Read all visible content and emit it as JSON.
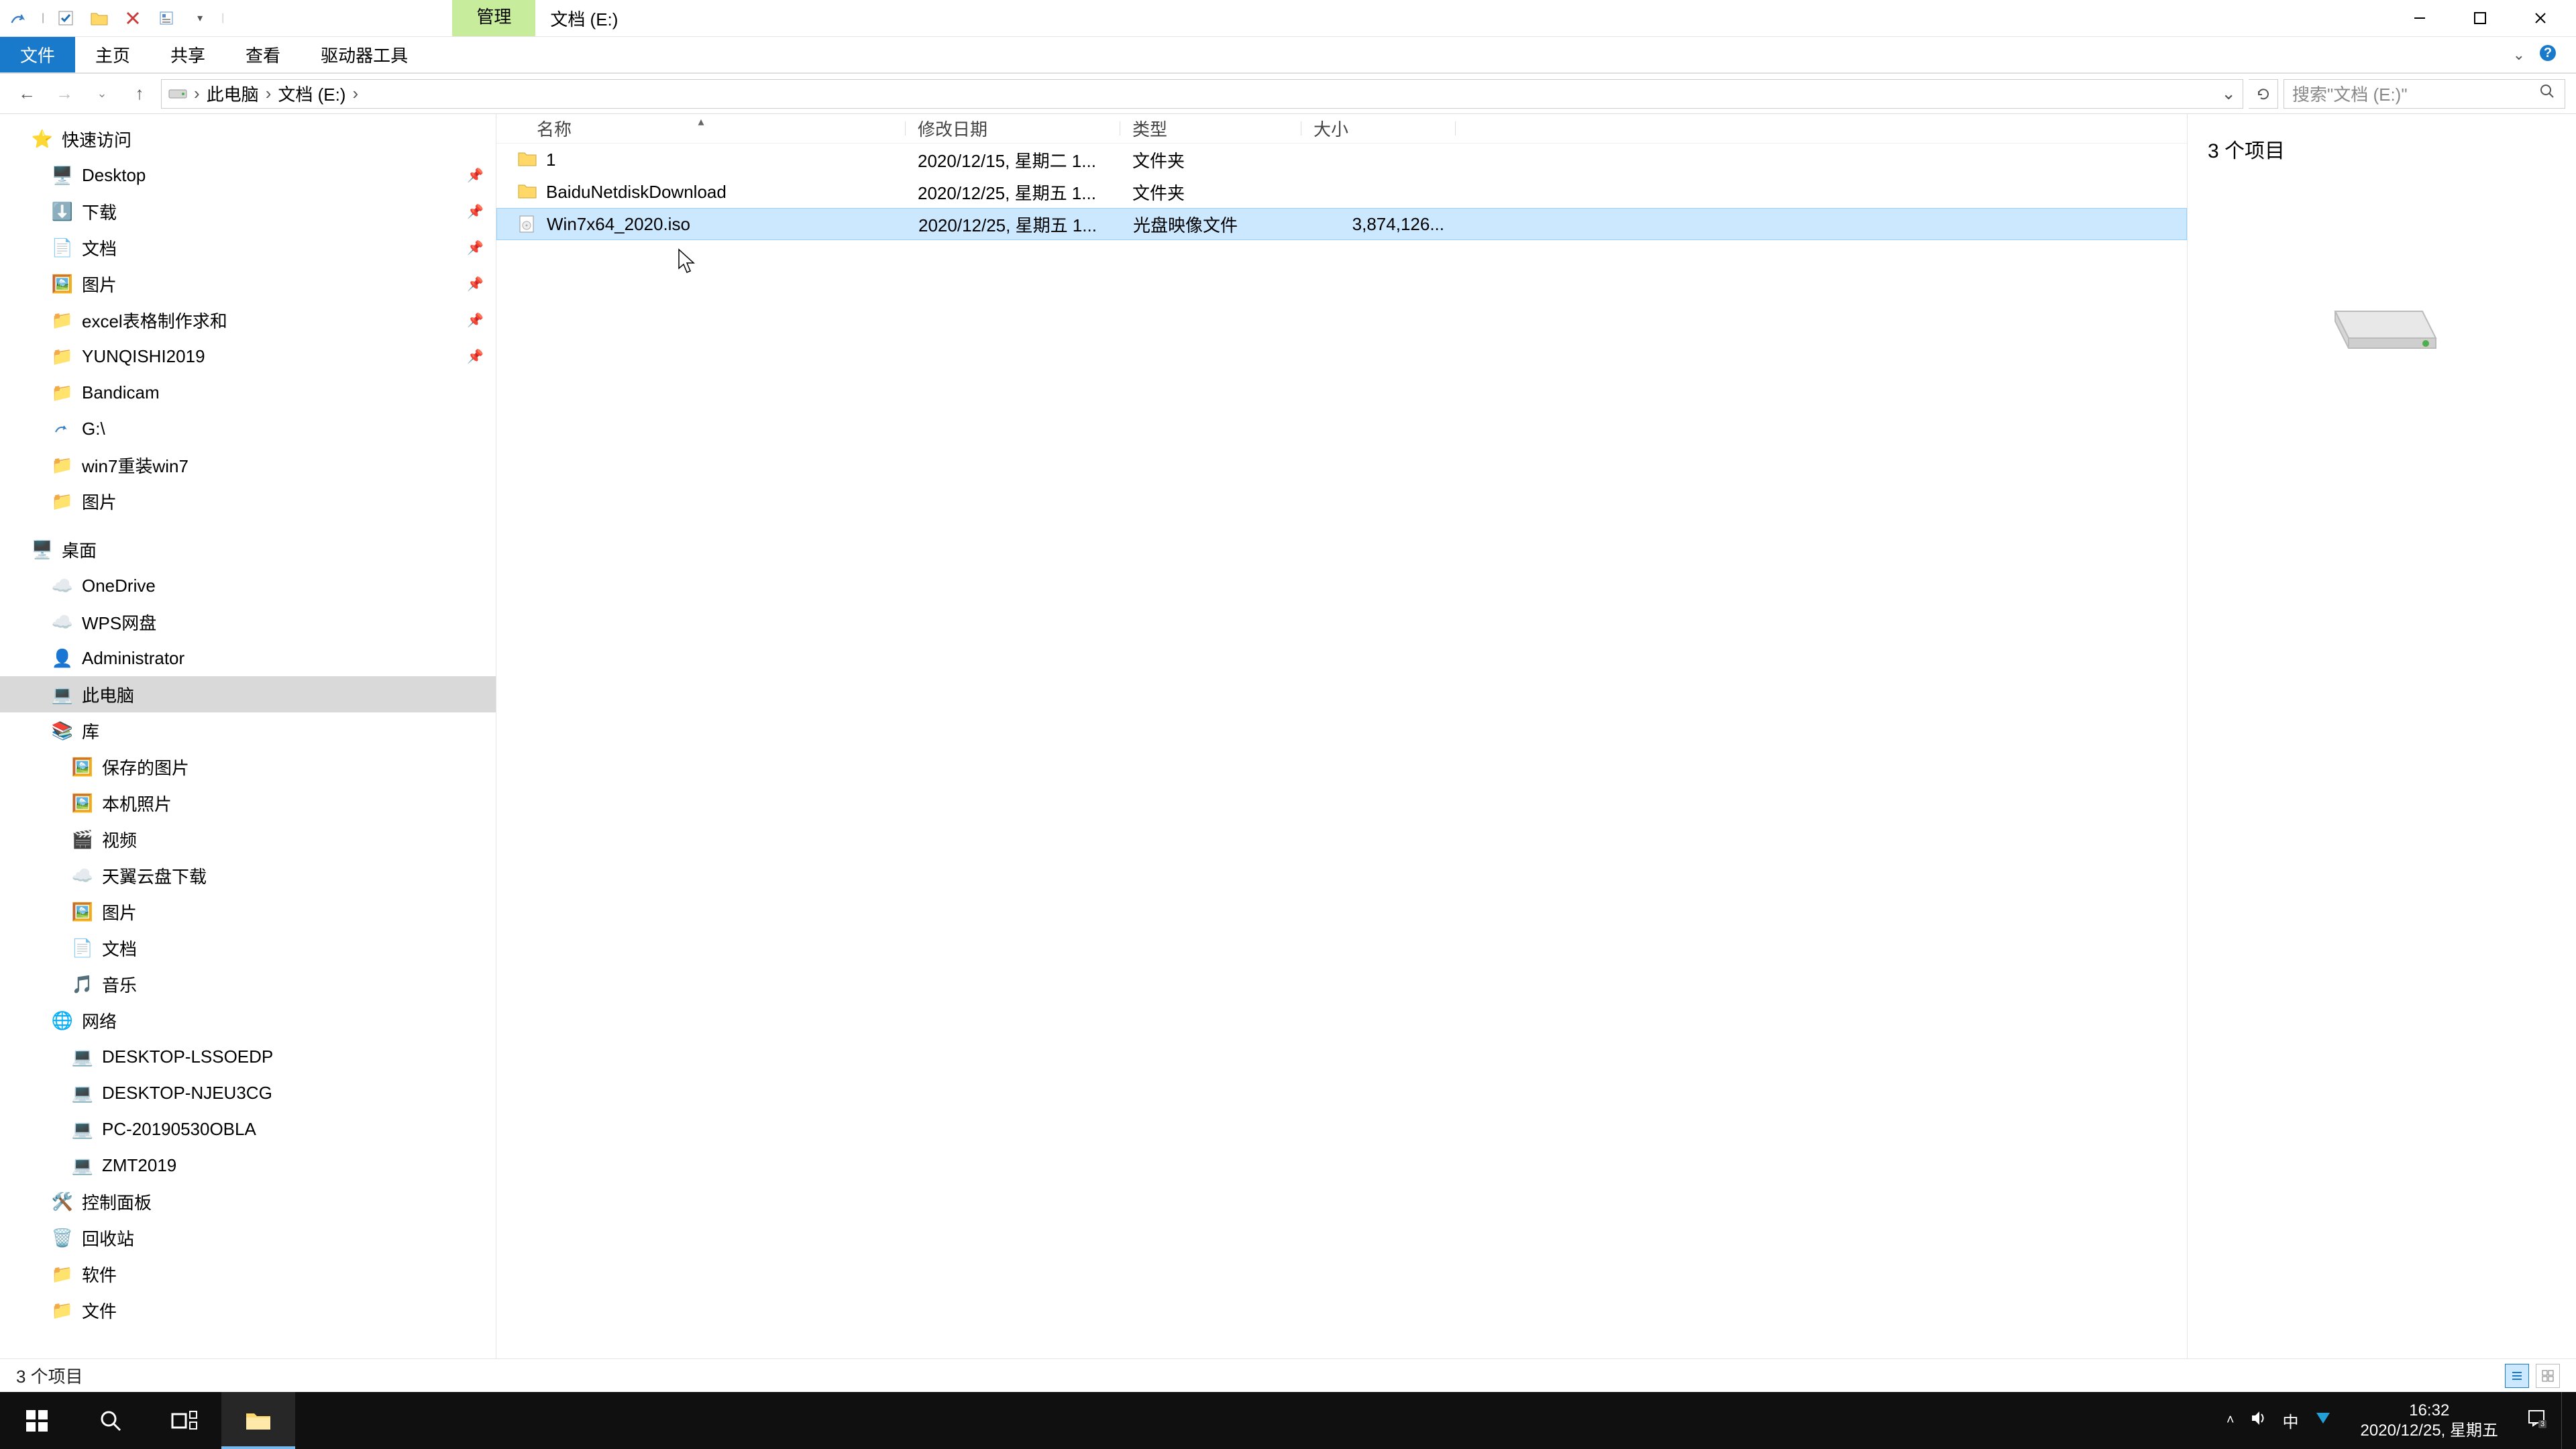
{
  "titlebar": {
    "manage_tab": "管理",
    "path_label": "文档 (E:)"
  },
  "ribbon": {
    "file": "文件",
    "home": "主页",
    "share": "共享",
    "view": "查看",
    "drive_tools": "驱动器工具"
  },
  "address": {
    "crumb1": "此电脑",
    "crumb2": "文档 (E:)"
  },
  "search": {
    "placeholder": "搜索\"文档 (E:)\""
  },
  "tree": {
    "quick_access": "快速访问",
    "desktop": "Desktop",
    "downloads": "下载",
    "documents": "文档",
    "pictures": "图片",
    "excel_req": "excel表格制作求和",
    "yunqishi": "YUNQISHI2019",
    "bandicam": "Bandicam",
    "gdrive": "G:\\",
    "win7reinstall": "win7重装win7",
    "pictures2": "图片",
    "desktop2": "桌面",
    "onedrive": "OneDrive",
    "wps": "WPS网盘",
    "administrator": "Administrator",
    "this_pc": "此电脑",
    "libraries": "库",
    "saved_pictures": "保存的图片",
    "camera_roll": "本机照片",
    "videos": "视频",
    "tianyi": "天翼云盘下载",
    "pictures3": "图片",
    "documents2": "文档",
    "music": "音乐",
    "network": "网络",
    "pc1": "DESKTOP-LSSOEDP",
    "pc2": "DESKTOP-NJEU3CG",
    "pc3": "PC-20190530OBLA",
    "pc4": "ZMT2019",
    "control_panel": "控制面板",
    "recycle": "回收站",
    "software": "软件",
    "files": "文件"
  },
  "columns": {
    "name": "名称",
    "date": "修改日期",
    "type": "类型",
    "size": "大小"
  },
  "files": [
    {
      "name": "1",
      "date": "2020/12/15, 星期二 1...",
      "type": "文件夹",
      "size": "",
      "icon": "folder"
    },
    {
      "name": "BaiduNetdiskDownload",
      "date": "2020/12/25, 星期五 1...",
      "type": "文件夹",
      "size": "",
      "icon": "folder"
    },
    {
      "name": "Win7x64_2020.iso",
      "date": "2020/12/25, 星期五 1...",
      "type": "光盘映像文件",
      "size": "3,874,126...",
      "icon": "iso",
      "selected": true
    }
  ],
  "preview": {
    "count": "3 个项目"
  },
  "status": {
    "text": "3 个项目"
  },
  "taskbar": {
    "time": "16:32",
    "date": "2020/12/25, 星期五",
    "ime": "中"
  }
}
